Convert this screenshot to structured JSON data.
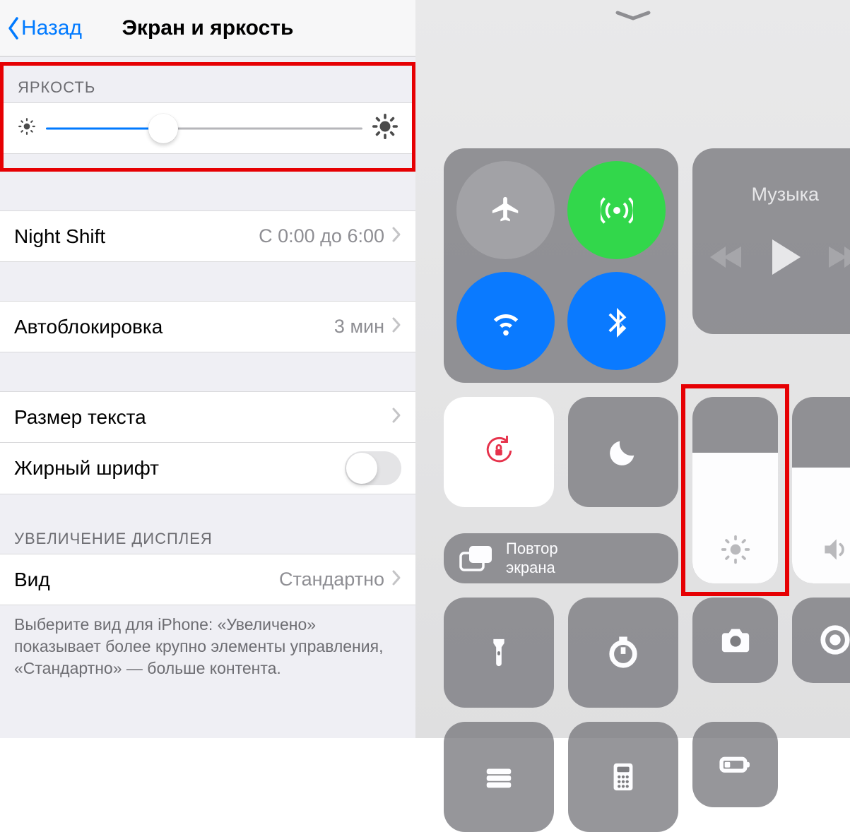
{
  "settings": {
    "back_label": "Назад",
    "title": "Экран и яркость",
    "brightness_label": "ЯРКОСТЬ",
    "brightness_percent": 37,
    "rows": {
      "night_shift": {
        "label": "Night Shift",
        "value": "С 0:00 до 6:00"
      },
      "auto_lock": {
        "label": "Автоблокировка",
        "value": "3 мин"
      },
      "text_size": {
        "label": "Размер текста"
      },
      "bold_text": {
        "label": "Жирный шрифт",
        "on": false
      },
      "view": {
        "label": "Вид",
        "value": "Стандартно"
      }
    },
    "zoom_label": "УВЕЛИЧЕНИЕ ДИСПЛЕЯ",
    "footnote": "Выберите вид для iPhone: «Увеличено» показывает более крупно элементы управления, «Стандартно» — больше контента."
  },
  "cc": {
    "music_label": "Музыка",
    "mirror_label": "Повтор\nэкрана",
    "brightness_fill": 70,
    "volume_fill": 62
  }
}
